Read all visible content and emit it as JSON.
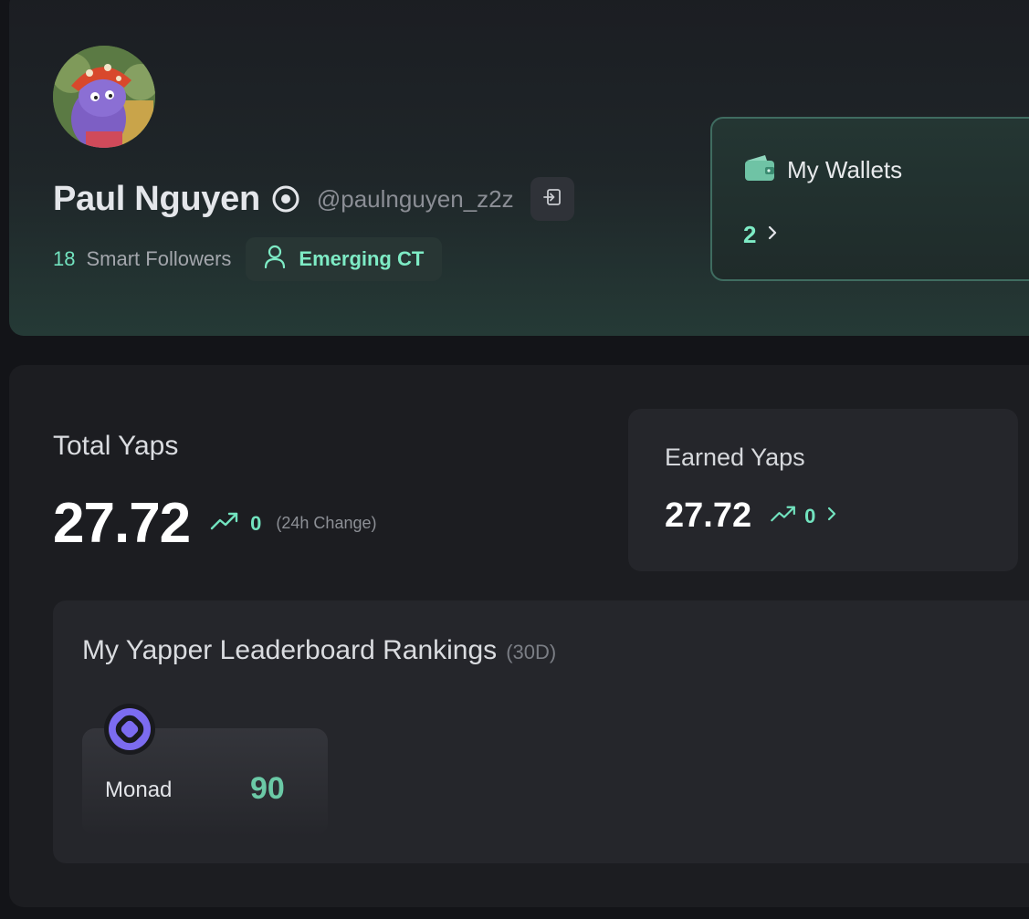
{
  "profile": {
    "display_name": "Paul Nguyen",
    "handle": "@paulnguyen_z2z",
    "smart_followers_count": "18",
    "smart_followers_label": "Smart Followers",
    "tier_label": "Emerging CT",
    "accent_color": "#72e3bf"
  },
  "wallets": {
    "title": "My Wallets",
    "count": "2"
  },
  "total_yaps": {
    "label": "Total Yaps",
    "value": "27.72",
    "change": "0",
    "change_note": "(24h Change)"
  },
  "earned_yaps": {
    "label": "Earned Yaps",
    "value": "27.72",
    "change": "0"
  },
  "leaderboard": {
    "title": "My Yapper Leaderboard Rankings",
    "period": "(30D)",
    "projects": [
      {
        "name": "Monad",
        "rank": "90",
        "logo_color": "#7c6cf0"
      }
    ]
  }
}
